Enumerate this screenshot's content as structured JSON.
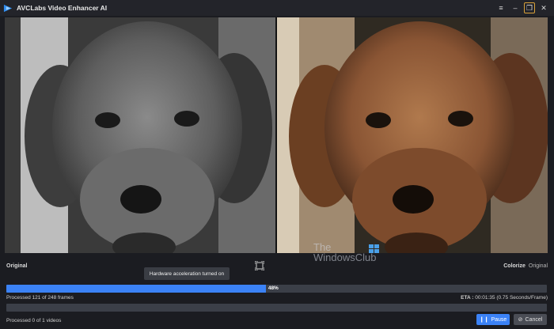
{
  "app": {
    "title": "AVCLabs Video Enhancer AI"
  },
  "window_controls": [
    {
      "name": "menu-icon",
      "glyph": "≡"
    },
    {
      "name": "minimize-icon",
      "glyph": "–"
    },
    {
      "name": "restore-icon",
      "glyph": "❐"
    },
    {
      "name": "close-icon",
      "glyph": "✕"
    }
  ],
  "preview": {
    "left_label": "Original",
    "right_labels": [
      "Colorize",
      "Original"
    ]
  },
  "watermark": {
    "line1": "The",
    "line2": "WindowsClub"
  },
  "tooltip": "Hardware acceleration turned on",
  "frames_progress": {
    "percent_label": "48%",
    "fraction": 0.48,
    "processed_text": "Processed 121 of 248 frames",
    "eta_label": "ETA :",
    "eta_value": "00:01:35 (0.75 Seconds/Frame)"
  },
  "videos_progress": {
    "fraction": 0,
    "processed_text": "Processed 0 of 1 videos"
  },
  "buttons": {
    "pause": "Pause",
    "cancel": "Cancel"
  },
  "colors": {
    "accent": "#3b82f6",
    "background": "#1b1c21",
    "track": "#3b3f48"
  }
}
